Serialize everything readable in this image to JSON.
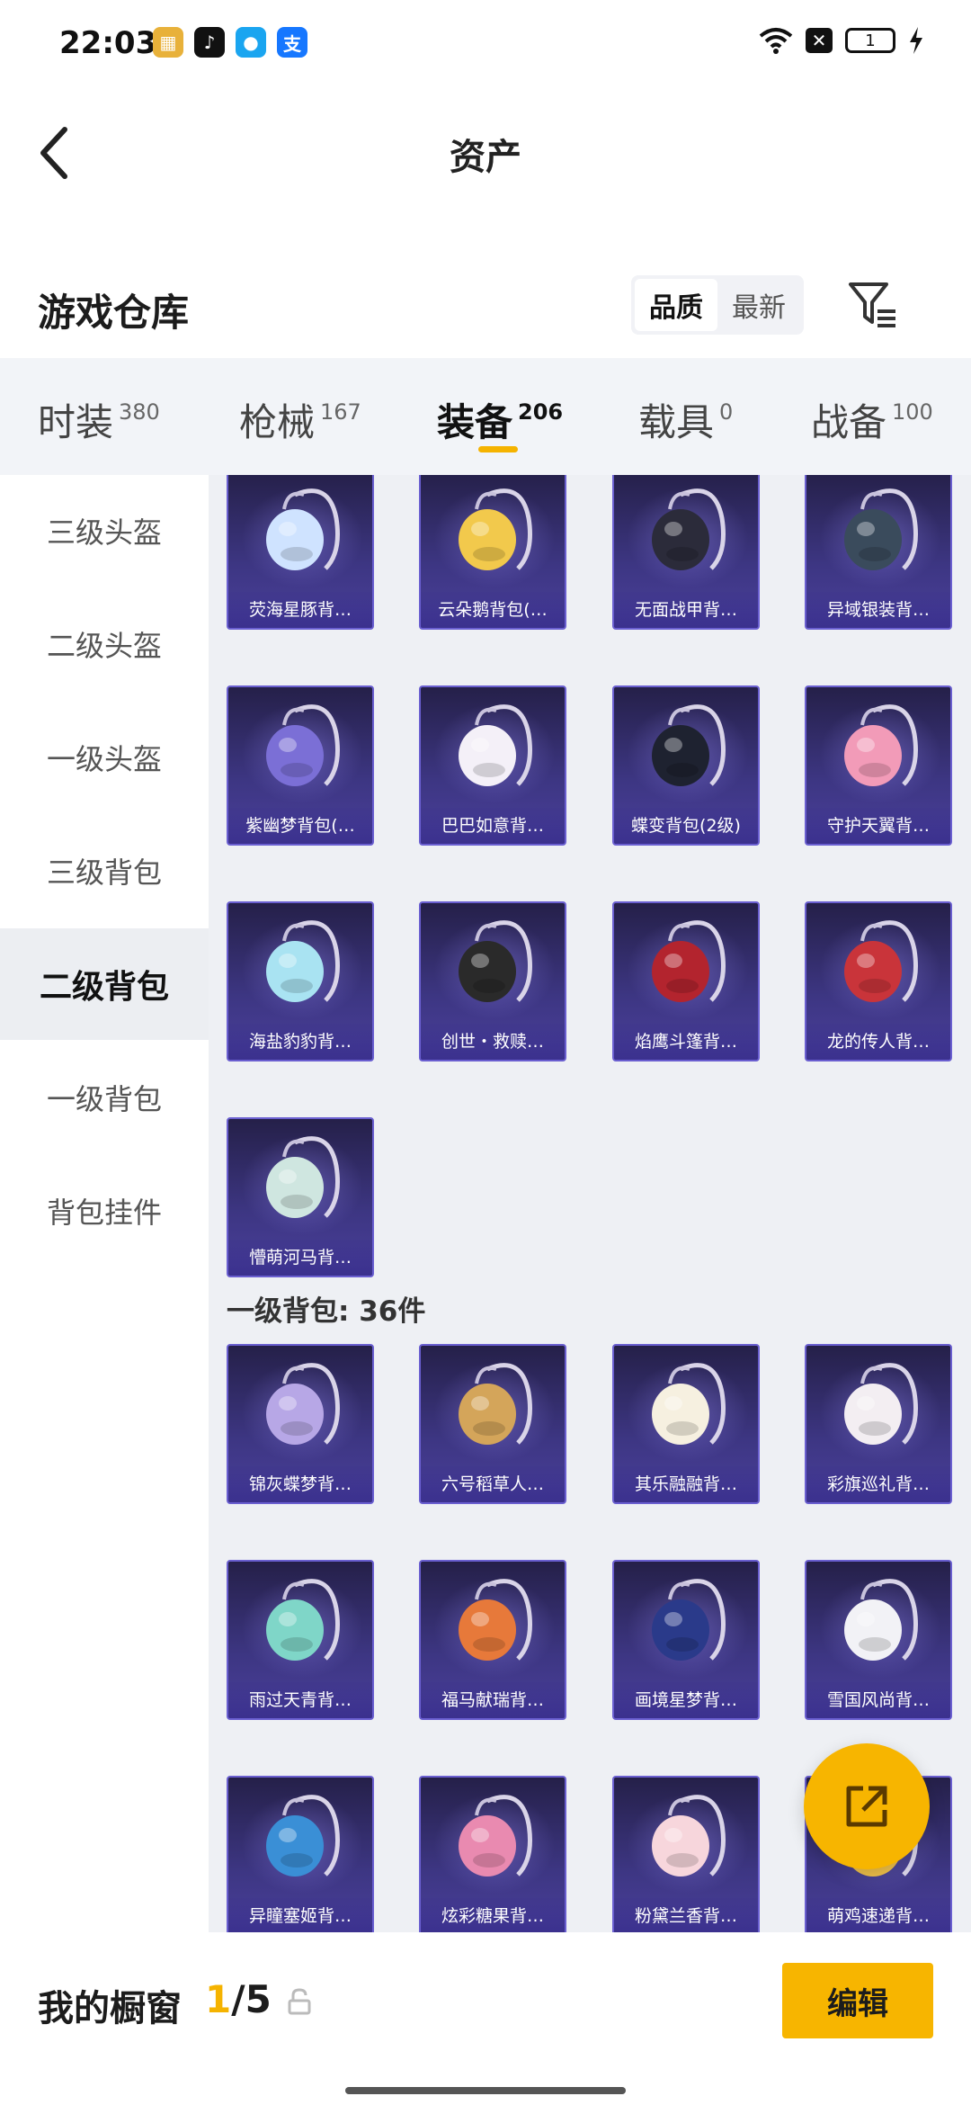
{
  "status": {
    "time": "22:03",
    "battery": "1"
  },
  "header": {
    "title": "资产"
  },
  "warehouse": {
    "title": "游戏仓库",
    "sort_options": [
      "品质",
      "最新"
    ],
    "sort_active": "品质"
  },
  "tabs": [
    {
      "label": "时装",
      "count": "380"
    },
    {
      "label": "枪械",
      "count": "167"
    },
    {
      "label": "装备",
      "count": "206"
    },
    {
      "label": "载具",
      "count": "0"
    },
    {
      "label": "战备",
      "count": "100"
    }
  ],
  "sidebar": {
    "items": [
      "三级头盔",
      "二级头盔",
      "一级头盔",
      "三级背包",
      "二级背包",
      "一级背包",
      "背包挂件"
    ],
    "active": "二级背包"
  },
  "level2_items": [
    "荧海星豚背…",
    "云朵鹅背包(…",
    "无面战甲背…",
    "异域银装背…",
    "紫幽梦背包(…",
    "巴巴如意背…",
    "蝶变背包(2级)",
    "守护天翼背…",
    "海盐豹豹背…",
    "创世・救赎…",
    "焰鹰斗篷背…",
    "龙的传人背…",
    "懵萌河马背…"
  ],
  "level1_section": {
    "title": "一级背包: 36件"
  },
  "level1_items": [
    "锦灰蝶梦背…",
    "六号稻草人…",
    "其乐融融背…",
    "彩旗巡礼背…",
    "雨过天青背…",
    "福马献瑞背…",
    "画境星梦背…",
    "雪国风尚背…",
    "异瞳塞姬背…",
    "炫彩糖果背…",
    "粉黛兰香背…",
    "萌鸡速递背…"
  ],
  "item_colors": [
    "#cfe3ff",
    "#f2c94c",
    "#2b2b3a",
    "#3a4b5c",
    "#7b6fd6",
    "#f4f0f8",
    "#1e2230",
    "#f29bb8",
    "#a9e3f2",
    "#2a2a2a",
    "#b3242e",
    "#c9343a",
    "#cfe6e0",
    "#b7a7e6",
    "#d4a55a",
    "#f6f0e0",
    "#f3eef2",
    "#7fd6c8",
    "#e7793a",
    "#2a3a8a",
    "#f2f2f6",
    "#3a8fd6",
    "#e98ab0",
    "#f7d6dc",
    "#f2c24a"
  ],
  "bottom": {
    "label": "我的橱窗",
    "current": "1",
    "total": "/5",
    "edit": "编辑"
  }
}
